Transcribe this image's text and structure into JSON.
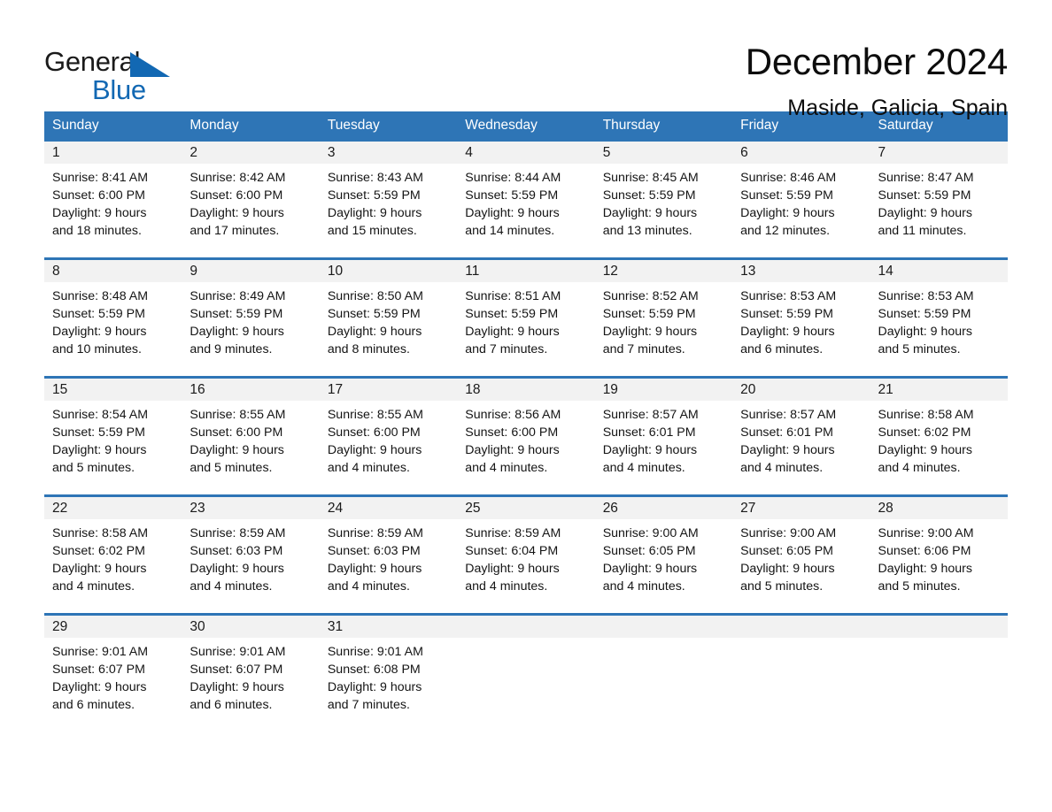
{
  "brand": {
    "name_part1": "General",
    "name_part2": "Blue",
    "accent_color": "#1268b3"
  },
  "header": {
    "title": "December 2024",
    "subtitle": "Maside, Galicia, Spain"
  },
  "theme": {
    "header_blue": "#2e75b6",
    "day_band_gray": "#f2f2f2",
    "text_color": "#141414"
  },
  "weekdays": [
    "Sunday",
    "Monday",
    "Tuesday",
    "Wednesday",
    "Thursday",
    "Friday",
    "Saturday"
  ],
  "weeks": [
    [
      {
        "day": "1",
        "sunrise": "Sunrise: 8:41 AM",
        "sunset": "Sunset: 6:00 PM",
        "daylight_line1": "Daylight: 9 hours",
        "daylight_line2": "and 18 minutes."
      },
      {
        "day": "2",
        "sunrise": "Sunrise: 8:42 AM",
        "sunset": "Sunset: 6:00 PM",
        "daylight_line1": "Daylight: 9 hours",
        "daylight_line2": "and 17 minutes."
      },
      {
        "day": "3",
        "sunrise": "Sunrise: 8:43 AM",
        "sunset": "Sunset: 5:59 PM",
        "daylight_line1": "Daylight: 9 hours",
        "daylight_line2": "and 15 minutes."
      },
      {
        "day": "4",
        "sunrise": "Sunrise: 8:44 AM",
        "sunset": "Sunset: 5:59 PM",
        "daylight_line1": "Daylight: 9 hours",
        "daylight_line2": "and 14 minutes."
      },
      {
        "day": "5",
        "sunrise": "Sunrise: 8:45 AM",
        "sunset": "Sunset: 5:59 PM",
        "daylight_line1": "Daylight: 9 hours",
        "daylight_line2": "and 13 minutes."
      },
      {
        "day": "6",
        "sunrise": "Sunrise: 8:46 AM",
        "sunset": "Sunset: 5:59 PM",
        "daylight_line1": "Daylight: 9 hours",
        "daylight_line2": "and 12 minutes."
      },
      {
        "day": "7",
        "sunrise": "Sunrise: 8:47 AM",
        "sunset": "Sunset: 5:59 PM",
        "daylight_line1": "Daylight: 9 hours",
        "daylight_line2": "and 11 minutes."
      }
    ],
    [
      {
        "day": "8",
        "sunrise": "Sunrise: 8:48 AM",
        "sunset": "Sunset: 5:59 PM",
        "daylight_line1": "Daylight: 9 hours",
        "daylight_line2": "and 10 minutes."
      },
      {
        "day": "9",
        "sunrise": "Sunrise: 8:49 AM",
        "sunset": "Sunset: 5:59 PM",
        "daylight_line1": "Daylight: 9 hours",
        "daylight_line2": "and 9 minutes."
      },
      {
        "day": "10",
        "sunrise": "Sunrise: 8:50 AM",
        "sunset": "Sunset: 5:59 PM",
        "daylight_line1": "Daylight: 9 hours",
        "daylight_line2": "and 8 minutes."
      },
      {
        "day": "11",
        "sunrise": "Sunrise: 8:51 AM",
        "sunset": "Sunset: 5:59 PM",
        "daylight_line1": "Daylight: 9 hours",
        "daylight_line2": "and 7 minutes."
      },
      {
        "day": "12",
        "sunrise": "Sunrise: 8:52 AM",
        "sunset": "Sunset: 5:59 PM",
        "daylight_line1": "Daylight: 9 hours",
        "daylight_line2": "and 7 minutes."
      },
      {
        "day": "13",
        "sunrise": "Sunrise: 8:53 AM",
        "sunset": "Sunset: 5:59 PM",
        "daylight_line1": "Daylight: 9 hours",
        "daylight_line2": "and 6 minutes."
      },
      {
        "day": "14",
        "sunrise": "Sunrise: 8:53 AM",
        "sunset": "Sunset: 5:59 PM",
        "daylight_line1": "Daylight: 9 hours",
        "daylight_line2": "and 5 minutes."
      }
    ],
    [
      {
        "day": "15",
        "sunrise": "Sunrise: 8:54 AM",
        "sunset": "Sunset: 5:59 PM",
        "daylight_line1": "Daylight: 9 hours",
        "daylight_line2": "and 5 minutes."
      },
      {
        "day": "16",
        "sunrise": "Sunrise: 8:55 AM",
        "sunset": "Sunset: 6:00 PM",
        "daylight_line1": "Daylight: 9 hours",
        "daylight_line2": "and 5 minutes."
      },
      {
        "day": "17",
        "sunrise": "Sunrise: 8:55 AM",
        "sunset": "Sunset: 6:00 PM",
        "daylight_line1": "Daylight: 9 hours",
        "daylight_line2": "and 4 minutes."
      },
      {
        "day": "18",
        "sunrise": "Sunrise: 8:56 AM",
        "sunset": "Sunset: 6:00 PM",
        "daylight_line1": "Daylight: 9 hours",
        "daylight_line2": "and 4 minutes."
      },
      {
        "day": "19",
        "sunrise": "Sunrise: 8:57 AM",
        "sunset": "Sunset: 6:01 PM",
        "daylight_line1": "Daylight: 9 hours",
        "daylight_line2": "and 4 minutes."
      },
      {
        "day": "20",
        "sunrise": "Sunrise: 8:57 AM",
        "sunset": "Sunset: 6:01 PM",
        "daylight_line1": "Daylight: 9 hours",
        "daylight_line2": "and 4 minutes."
      },
      {
        "day": "21",
        "sunrise": "Sunrise: 8:58 AM",
        "sunset": "Sunset: 6:02 PM",
        "daylight_line1": "Daylight: 9 hours",
        "daylight_line2": "and 4 minutes."
      }
    ],
    [
      {
        "day": "22",
        "sunrise": "Sunrise: 8:58 AM",
        "sunset": "Sunset: 6:02 PM",
        "daylight_line1": "Daylight: 9 hours",
        "daylight_line2": "and 4 minutes."
      },
      {
        "day": "23",
        "sunrise": "Sunrise: 8:59 AM",
        "sunset": "Sunset: 6:03 PM",
        "daylight_line1": "Daylight: 9 hours",
        "daylight_line2": "and 4 minutes."
      },
      {
        "day": "24",
        "sunrise": "Sunrise: 8:59 AM",
        "sunset": "Sunset: 6:03 PM",
        "daylight_line1": "Daylight: 9 hours",
        "daylight_line2": "and 4 minutes."
      },
      {
        "day": "25",
        "sunrise": "Sunrise: 8:59 AM",
        "sunset": "Sunset: 6:04 PM",
        "daylight_line1": "Daylight: 9 hours",
        "daylight_line2": "and 4 minutes."
      },
      {
        "day": "26",
        "sunrise": "Sunrise: 9:00 AM",
        "sunset": "Sunset: 6:05 PM",
        "daylight_line1": "Daylight: 9 hours",
        "daylight_line2": "and 4 minutes."
      },
      {
        "day": "27",
        "sunrise": "Sunrise: 9:00 AM",
        "sunset": "Sunset: 6:05 PM",
        "daylight_line1": "Daylight: 9 hours",
        "daylight_line2": "and 5 minutes."
      },
      {
        "day": "28",
        "sunrise": "Sunrise: 9:00 AM",
        "sunset": "Sunset: 6:06 PM",
        "daylight_line1": "Daylight: 9 hours",
        "daylight_line2": "and 5 minutes."
      }
    ],
    [
      {
        "day": "29",
        "sunrise": "Sunrise: 9:01 AM",
        "sunset": "Sunset: 6:07 PM",
        "daylight_line1": "Daylight: 9 hours",
        "daylight_line2": "and 6 minutes."
      },
      {
        "day": "30",
        "sunrise": "Sunrise: 9:01 AM",
        "sunset": "Sunset: 6:07 PM",
        "daylight_line1": "Daylight: 9 hours",
        "daylight_line2": "and 6 minutes."
      },
      {
        "day": "31",
        "sunrise": "Sunrise: 9:01 AM",
        "sunset": "Sunset: 6:08 PM",
        "daylight_line1": "Daylight: 9 hours",
        "daylight_line2": "and 7 minutes."
      },
      {
        "day": "",
        "sunrise": "",
        "sunset": "",
        "daylight_line1": "",
        "daylight_line2": ""
      },
      {
        "day": "",
        "sunrise": "",
        "sunset": "",
        "daylight_line1": "",
        "daylight_line2": ""
      },
      {
        "day": "",
        "sunrise": "",
        "sunset": "",
        "daylight_line1": "",
        "daylight_line2": ""
      },
      {
        "day": "",
        "sunrise": "",
        "sunset": "",
        "daylight_line1": "",
        "daylight_line2": ""
      }
    ]
  ]
}
